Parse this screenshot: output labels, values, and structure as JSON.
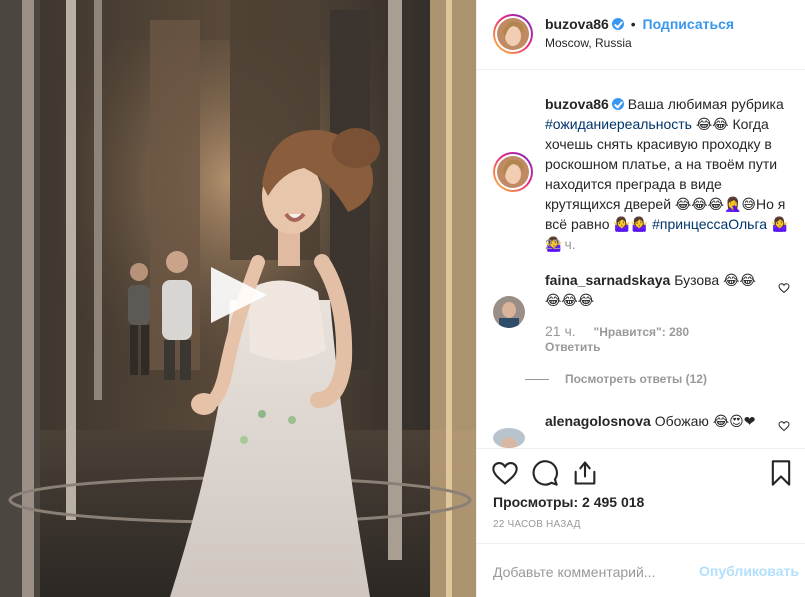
{
  "header": {
    "username": "buzova86",
    "follow_label": "Подписаться",
    "location": "Moscow, Russia"
  },
  "caption": {
    "username": "buzova86",
    "text_1": "Ваша любимая рубрика",
    "hashtag_1": "#ожиданиереальность",
    "text_2": "😂😂 Когда хочешь снять красивую проходку в роскошном платье, а на твоём пути находится преграда в виде крутящихся дверей 😂😂😂🤦‍♀️😅Но я всё равно 🤷‍♀️🤷‍♀️",
    "hashtag_2": "#принцессаОльга",
    "text_3": "🤷‍♀️🤷‍♀️",
    "time": "22 ч."
  },
  "comments": [
    {
      "username": "faina_sarnadskaya",
      "text": "Бузова 😂😂😂😂😂",
      "time": "21 ч.",
      "likes": "\"Нравится\": 280",
      "reply_label": "Ответить",
      "view_replies": "Посмотреть ответы (12)"
    },
    {
      "username": "alenagolosnova",
      "text": "Обожаю 😂😍❤"
    }
  ],
  "stats": {
    "views": "Просмотры: 2 495 018",
    "posted_ago": "22 ЧАСОВ НАЗАД"
  },
  "add_comment": {
    "placeholder": "Добавьте комментарий...",
    "publish_label": "Опубликовать"
  },
  "colors": {
    "accent": "#3897f0",
    "hashtag": "#003569",
    "muted": "#999999",
    "publish_disabled": "#b2dffc"
  },
  "icons": {
    "play": "play-icon",
    "like": "heart-icon",
    "comment": "comment-icon",
    "share": "share-icon",
    "save": "bookmark-icon",
    "verified": "verified-badge-icon"
  }
}
